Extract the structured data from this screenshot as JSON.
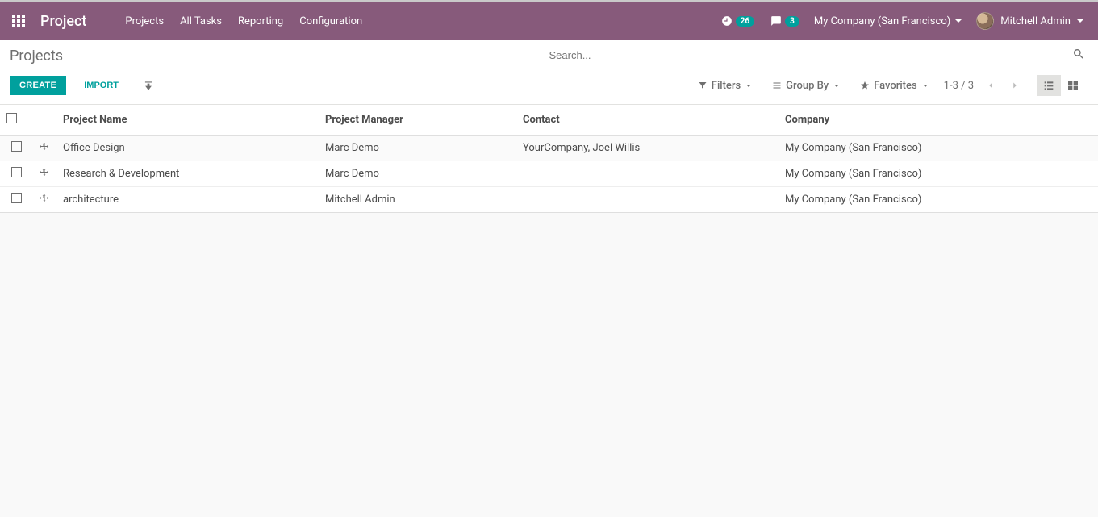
{
  "navbar": {
    "brand": "Project",
    "menu": [
      {
        "label": "Projects"
      },
      {
        "label": "All Tasks"
      },
      {
        "label": "Reporting"
      },
      {
        "label": "Configuration"
      }
    ],
    "activity_count": "26",
    "messages_count": "3",
    "company": "My Company (San Francisco)",
    "user_name": "Mitchell Admin"
  },
  "breadcrumb": "Projects",
  "search": {
    "placeholder": "Search..."
  },
  "controls": {
    "create": "Create",
    "import": "Import",
    "filters": "Filters",
    "group_by": "Group By",
    "favorites": "Favorites",
    "pager": "1-3 / 3"
  },
  "table": {
    "headers": {
      "name": "Project Name",
      "manager": "Project Manager",
      "contact": "Contact",
      "company": "Company"
    },
    "rows": [
      {
        "name": "Office Design",
        "manager": "Marc Demo",
        "contact": "YourCompany, Joel Willis",
        "company": "My Company (San Francisco)"
      },
      {
        "name": "Research & Development",
        "manager": "Marc Demo",
        "contact": "",
        "company": "My Company (San Francisco)"
      },
      {
        "name": "architecture",
        "manager": "Mitchell Admin",
        "contact": "",
        "company": "My Company (San Francisco)"
      }
    ]
  }
}
